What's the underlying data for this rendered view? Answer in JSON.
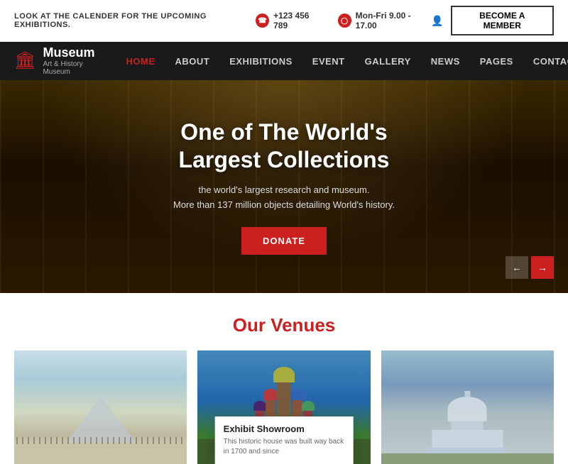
{
  "topbar": {
    "message": "LOOK AT THE CALENDER FOR THE UPCOMING EXHIBITIONS.",
    "phone": "+123 456 789",
    "hours": "Mon-Fri 9.00 - 17.00",
    "member_btn": "BECOME A MEMBER"
  },
  "navbar": {
    "logo_title": "Museum",
    "logo_subtitle": "Art & History Museum",
    "links": [
      {
        "label": "HOME",
        "active": true
      },
      {
        "label": "ABOUT",
        "active": false
      },
      {
        "label": "EXHIBITIONS",
        "active": false
      },
      {
        "label": "EVENT",
        "active": false
      },
      {
        "label": "GALLERY",
        "active": false
      },
      {
        "label": "NEWS",
        "active": false
      },
      {
        "label": "PAGES",
        "active": false
      },
      {
        "label": "CONTACT",
        "active": false
      }
    ]
  },
  "hero": {
    "title": "One of The World's\nLargest Collections",
    "subtitle_line1": "the world's largest research and museum.",
    "subtitle_line2": "More than 137 million objects detailing World's history.",
    "donate_btn": "DONATE"
  },
  "venues": {
    "section_title_highlight": "Our",
    "section_title_rest": " Venues",
    "cards": [
      {
        "id": "louvre",
        "type": "image-only"
      },
      {
        "id": "st-basil",
        "type": "image-with-overlay",
        "overlay_title": "Exhibit Showroom",
        "overlay_text": "This historic house was built way back in 1700 and since"
      },
      {
        "id": "capitol",
        "type": "image-only"
      }
    ]
  }
}
